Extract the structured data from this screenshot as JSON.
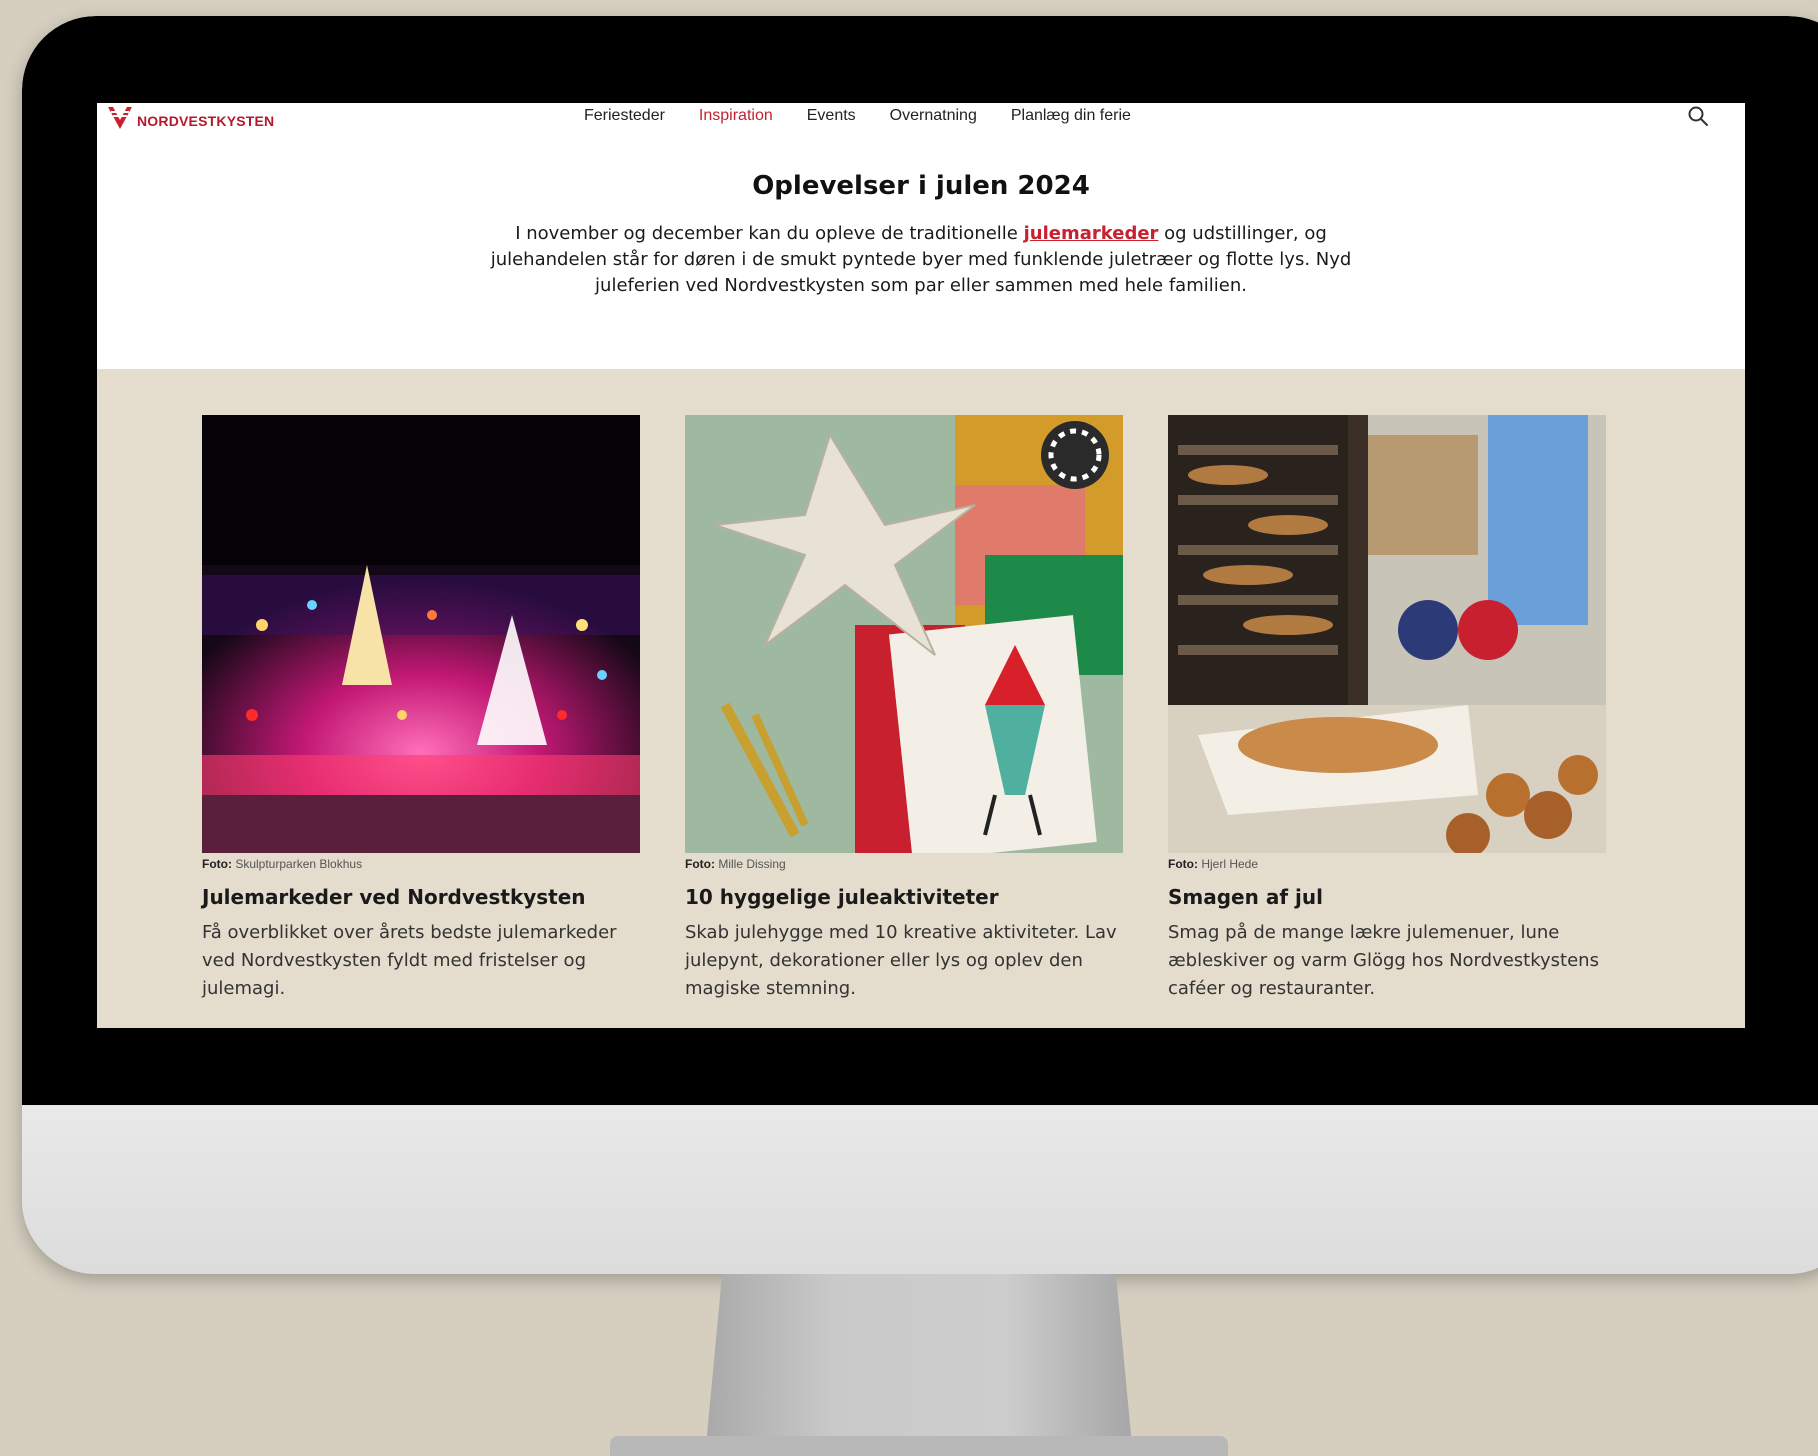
{
  "site": {
    "logo_text": "NORDVESTKYSTEN",
    "brand_color": "#c8202f"
  },
  "nav": {
    "items": [
      {
        "label": "Feriesteder",
        "active": false
      },
      {
        "label": "Inspiration",
        "active": true
      },
      {
        "label": "Events",
        "active": false
      },
      {
        "label": "Overnatning",
        "active": false
      },
      {
        "label": "Planlæg din ferie",
        "active": false
      }
    ],
    "search_icon": "search-icon"
  },
  "hero": {
    "title": "Oplevelser i julen 2024",
    "text_before": "I november og december kan du opleve de traditionelle ",
    "link": "julemarkeder",
    "text_after": " og udstillinger, og julehandelen står for døren i de smukt pyntede byer med funklende juletræer og flotte lys. Nyd juleferien ved Nordvestkysten som par eller sammen med hele familien."
  },
  "cards": [
    {
      "credit_label": "Foto:",
      "credit": "Skulpturparken Blokhus",
      "title": "Julemarkeder ved Nordvestkysten",
      "text": "Få overblikket over årets bedste julemarkeder ved Nordvestkysten fyldt med fristelser og julemagi."
    },
    {
      "credit_label": "Foto:",
      "credit": "Mille Dissing",
      "title": "10 hyggelige juleaktiviteter",
      "text": "Skab julehygge med 10 kreative aktiviteter. Lav julepynt, dekorationer eller lys og oplev den magiske stemning."
    },
    {
      "credit_label": "Foto:",
      "credit": "Hjerl Hede",
      "title": "Smagen af jul",
      "text": "Smag på de mange lækre julemenuer, lune æbleskiver og varm Glögg hos Nordvestkystens caféer og restauranter."
    }
  ]
}
